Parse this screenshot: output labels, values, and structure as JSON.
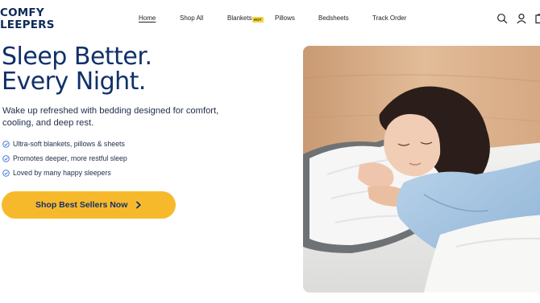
{
  "brand": {
    "line1": "COMFY",
    "line2": "LEEPERS"
  },
  "nav": {
    "items": [
      {
        "label": "Home",
        "active": true
      },
      {
        "label": "Shop All"
      },
      {
        "label": "Blankets",
        "badge": "HOT"
      },
      {
        "label": "Pillows"
      },
      {
        "label": "Bedsheets"
      },
      {
        "label": "Track Order"
      }
    ]
  },
  "header_icons": [
    "search-icon",
    "account-icon",
    "cart-icon"
  ],
  "hero": {
    "headline_line1": "Sleep Better.",
    "headline_line2": "Every Night.",
    "subtitle": "Wake up refreshed with bedding designed for comfort, cooling, and deep rest.",
    "bullets": [
      "Ultra-soft blankets, pillows & sheets",
      "Promotes deeper, more restful sleep",
      "Loved by many happy sleepers"
    ],
    "cta_label": "Shop Best Sellers Now"
  },
  "colors": {
    "navy": "#11306a",
    "cta": "#f7b92c",
    "hot_badge": "#f6d33b",
    "check": "#2f6fd6"
  }
}
